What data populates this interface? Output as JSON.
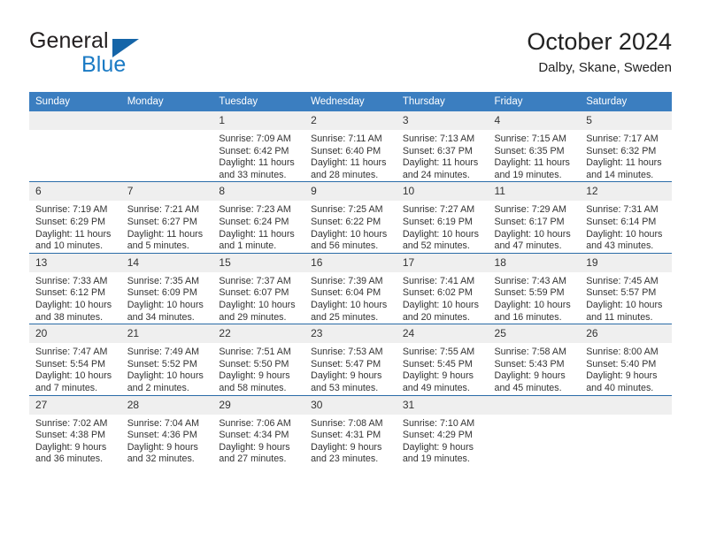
{
  "brand": {
    "name_part1": "General",
    "name_part2": "Blue",
    "logo_icon": "triangle-flag-icon"
  },
  "header": {
    "title": "October 2024",
    "subtitle": "Dalby, Skane, Sweden"
  },
  "colors": {
    "header_blue": "#3b7ec0",
    "separator_blue": "#2a6ca8",
    "daynum_band": "#efefef",
    "brand_blue": "#1a7ac4",
    "logo_blue": "#1565a8",
    "text": "#333333"
  },
  "weekday_headers": [
    "Sunday",
    "Monday",
    "Tuesday",
    "Wednesday",
    "Thursday",
    "Friday",
    "Saturday"
  ],
  "weeks": [
    [
      {
        "day": "",
        "lines": []
      },
      {
        "day": "",
        "lines": []
      },
      {
        "day": "1",
        "lines": [
          "Sunrise: 7:09 AM",
          "Sunset: 6:42 PM",
          "Daylight: 11 hours",
          "and 33 minutes."
        ]
      },
      {
        "day": "2",
        "lines": [
          "Sunrise: 7:11 AM",
          "Sunset: 6:40 PM",
          "Daylight: 11 hours",
          "and 28 minutes."
        ]
      },
      {
        "day": "3",
        "lines": [
          "Sunrise: 7:13 AM",
          "Sunset: 6:37 PM",
          "Daylight: 11 hours",
          "and 24 minutes."
        ]
      },
      {
        "day": "4",
        "lines": [
          "Sunrise: 7:15 AM",
          "Sunset: 6:35 PM",
          "Daylight: 11 hours",
          "and 19 minutes."
        ]
      },
      {
        "day": "5",
        "lines": [
          "Sunrise: 7:17 AM",
          "Sunset: 6:32 PM",
          "Daylight: 11 hours",
          "and 14 minutes."
        ]
      }
    ],
    [
      {
        "day": "6",
        "lines": [
          "Sunrise: 7:19 AM",
          "Sunset: 6:29 PM",
          "Daylight: 11 hours",
          "and 10 minutes."
        ]
      },
      {
        "day": "7",
        "lines": [
          "Sunrise: 7:21 AM",
          "Sunset: 6:27 PM",
          "Daylight: 11 hours",
          "and 5 minutes."
        ]
      },
      {
        "day": "8",
        "lines": [
          "Sunrise: 7:23 AM",
          "Sunset: 6:24 PM",
          "Daylight: 11 hours",
          "and 1 minute."
        ]
      },
      {
        "day": "9",
        "lines": [
          "Sunrise: 7:25 AM",
          "Sunset: 6:22 PM",
          "Daylight: 10 hours",
          "and 56 minutes."
        ]
      },
      {
        "day": "10",
        "lines": [
          "Sunrise: 7:27 AM",
          "Sunset: 6:19 PM",
          "Daylight: 10 hours",
          "and 52 minutes."
        ]
      },
      {
        "day": "11",
        "lines": [
          "Sunrise: 7:29 AM",
          "Sunset: 6:17 PM",
          "Daylight: 10 hours",
          "and 47 minutes."
        ]
      },
      {
        "day": "12",
        "lines": [
          "Sunrise: 7:31 AM",
          "Sunset: 6:14 PM",
          "Daylight: 10 hours",
          "and 43 minutes."
        ]
      }
    ],
    [
      {
        "day": "13",
        "lines": [
          "Sunrise: 7:33 AM",
          "Sunset: 6:12 PM",
          "Daylight: 10 hours",
          "and 38 minutes."
        ]
      },
      {
        "day": "14",
        "lines": [
          "Sunrise: 7:35 AM",
          "Sunset: 6:09 PM",
          "Daylight: 10 hours",
          "and 34 minutes."
        ]
      },
      {
        "day": "15",
        "lines": [
          "Sunrise: 7:37 AM",
          "Sunset: 6:07 PM",
          "Daylight: 10 hours",
          "and 29 minutes."
        ]
      },
      {
        "day": "16",
        "lines": [
          "Sunrise: 7:39 AM",
          "Sunset: 6:04 PM",
          "Daylight: 10 hours",
          "and 25 minutes."
        ]
      },
      {
        "day": "17",
        "lines": [
          "Sunrise: 7:41 AM",
          "Sunset: 6:02 PM",
          "Daylight: 10 hours",
          "and 20 minutes."
        ]
      },
      {
        "day": "18",
        "lines": [
          "Sunrise: 7:43 AM",
          "Sunset: 5:59 PM",
          "Daylight: 10 hours",
          "and 16 minutes."
        ]
      },
      {
        "day": "19",
        "lines": [
          "Sunrise: 7:45 AM",
          "Sunset: 5:57 PM",
          "Daylight: 10 hours",
          "and 11 minutes."
        ]
      }
    ],
    [
      {
        "day": "20",
        "lines": [
          "Sunrise: 7:47 AM",
          "Sunset: 5:54 PM",
          "Daylight: 10 hours",
          "and 7 minutes."
        ]
      },
      {
        "day": "21",
        "lines": [
          "Sunrise: 7:49 AM",
          "Sunset: 5:52 PM",
          "Daylight: 10 hours",
          "and 2 minutes."
        ]
      },
      {
        "day": "22",
        "lines": [
          "Sunrise: 7:51 AM",
          "Sunset: 5:50 PM",
          "Daylight: 9 hours",
          "and 58 minutes."
        ]
      },
      {
        "day": "23",
        "lines": [
          "Sunrise: 7:53 AM",
          "Sunset: 5:47 PM",
          "Daylight: 9 hours",
          "and 53 minutes."
        ]
      },
      {
        "day": "24",
        "lines": [
          "Sunrise: 7:55 AM",
          "Sunset: 5:45 PM",
          "Daylight: 9 hours",
          "and 49 minutes."
        ]
      },
      {
        "day": "25",
        "lines": [
          "Sunrise: 7:58 AM",
          "Sunset: 5:43 PM",
          "Daylight: 9 hours",
          "and 45 minutes."
        ]
      },
      {
        "day": "26",
        "lines": [
          "Sunrise: 8:00 AM",
          "Sunset: 5:40 PM",
          "Daylight: 9 hours",
          "and 40 minutes."
        ]
      }
    ],
    [
      {
        "day": "27",
        "lines": [
          "Sunrise: 7:02 AM",
          "Sunset: 4:38 PM",
          "Daylight: 9 hours",
          "and 36 minutes."
        ]
      },
      {
        "day": "28",
        "lines": [
          "Sunrise: 7:04 AM",
          "Sunset: 4:36 PM",
          "Daylight: 9 hours",
          "and 32 minutes."
        ]
      },
      {
        "day": "29",
        "lines": [
          "Sunrise: 7:06 AM",
          "Sunset: 4:34 PM",
          "Daylight: 9 hours",
          "and 27 minutes."
        ]
      },
      {
        "day": "30",
        "lines": [
          "Sunrise: 7:08 AM",
          "Sunset: 4:31 PM",
          "Daylight: 9 hours",
          "and 23 minutes."
        ]
      },
      {
        "day": "31",
        "lines": [
          "Sunrise: 7:10 AM",
          "Sunset: 4:29 PM",
          "Daylight: 9 hours",
          "and 19 minutes."
        ]
      },
      {
        "day": "",
        "lines": []
      },
      {
        "day": "",
        "lines": []
      }
    ]
  ]
}
